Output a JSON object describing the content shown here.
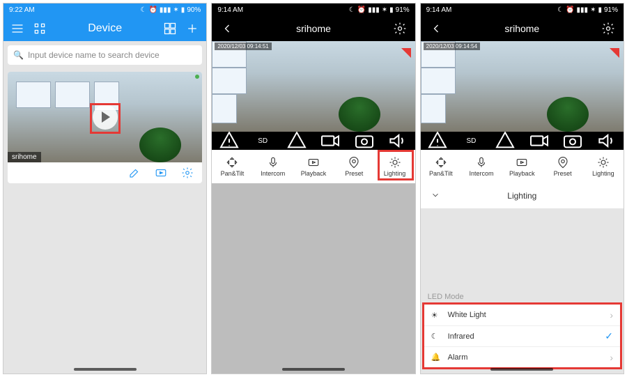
{
  "screen1": {
    "status": {
      "time": "9:22 AM",
      "battery": "90%"
    },
    "header": {
      "title": "Device"
    },
    "search_placeholder": "Input device name to search device",
    "device": {
      "name": "srihome"
    }
  },
  "screen2": {
    "status": {
      "time": "9:14 AM",
      "battery": "91%"
    },
    "header": {
      "title": "srihome"
    },
    "livebar": {
      "quality": "SD"
    },
    "tools": {
      "pantilt": "Pan&Tilt",
      "intercom": "Intercom",
      "playback": "Playback",
      "preset": "Preset",
      "lighting": "Lighting"
    }
  },
  "screen3": {
    "status": {
      "time": "9:14 AM",
      "battery": "91%"
    },
    "header": {
      "title": "srihome"
    },
    "livebar": {
      "quality": "SD"
    },
    "tools": {
      "pantilt": "Pan&Tilt",
      "intercom": "Intercom",
      "playback": "Playback",
      "preset": "Preset",
      "lighting": "Lighting"
    },
    "panel": {
      "title": "Lighting",
      "section": "LED Mode"
    },
    "led_modes": {
      "white": "White Light",
      "infrared": "Infrared",
      "alarm": "Alarm"
    }
  }
}
